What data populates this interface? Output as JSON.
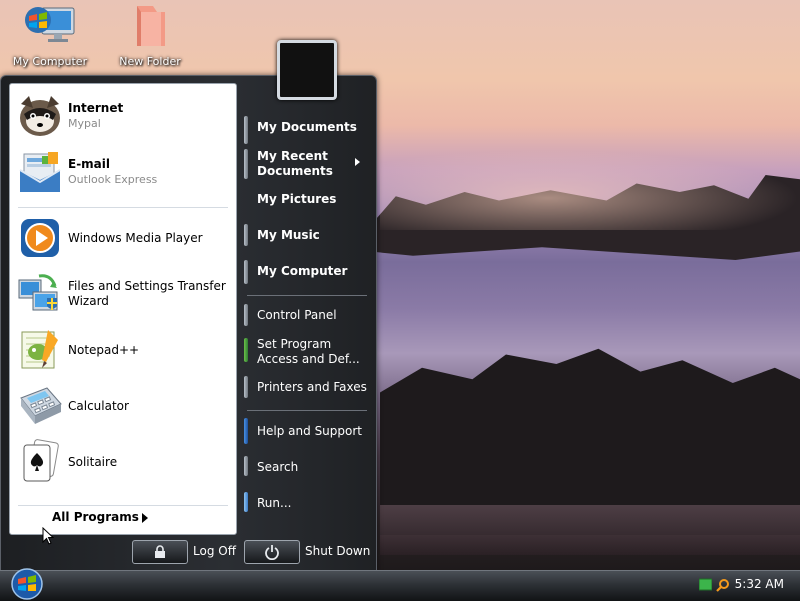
{
  "desktop": {
    "icons": [
      {
        "label": "My Computer",
        "icon": "my-computer-icon"
      },
      {
        "label": "New Folder",
        "icon": "folder-icon"
      }
    ]
  },
  "start_menu": {
    "pinned": [
      {
        "title": "Internet",
        "subtitle": "Mypal",
        "icon": "mypal-browser-icon"
      },
      {
        "title": "E-mail",
        "subtitle": "Outlook Express",
        "icon": "outlook-express-icon"
      }
    ],
    "recent": [
      {
        "title": "Windows Media Player",
        "icon": "media-player-icon"
      },
      {
        "title": "Files and Settings Transfer Wizard",
        "icon": "transfer-wizard-icon"
      },
      {
        "title": "Notepad++",
        "icon": "notepad-plus-plus-icon"
      },
      {
        "title": "Calculator",
        "icon": "calculator-icon"
      },
      {
        "title": "Solitaire",
        "icon": "solitaire-icon"
      }
    ],
    "all_programs": "All Programs",
    "right": [
      {
        "label": "My Documents"
      },
      {
        "label": "My Recent\nDocuments"
      },
      {
        "label": "My Pictures"
      },
      {
        "label": "My Music"
      },
      {
        "label": "My Computer"
      },
      {
        "label": "Control Panel"
      },
      {
        "label": "Set Program\nAccess and Def..."
      },
      {
        "label": "Printers and Faxes"
      },
      {
        "label": "Help and Support"
      },
      {
        "label": "Search"
      },
      {
        "label": "Run..."
      }
    ],
    "log_off": "Log Off",
    "shut_down": "Shut Down"
  },
  "taskbar": {
    "clock": "5:32 AM",
    "tray_icons": [
      "network-icon",
      "search-icon"
    ]
  },
  "colors": {
    "menu_bg": "#2b2e33",
    "taskbar_bg": "#2d3136",
    "left_pane_bg": "#ffffff"
  }
}
